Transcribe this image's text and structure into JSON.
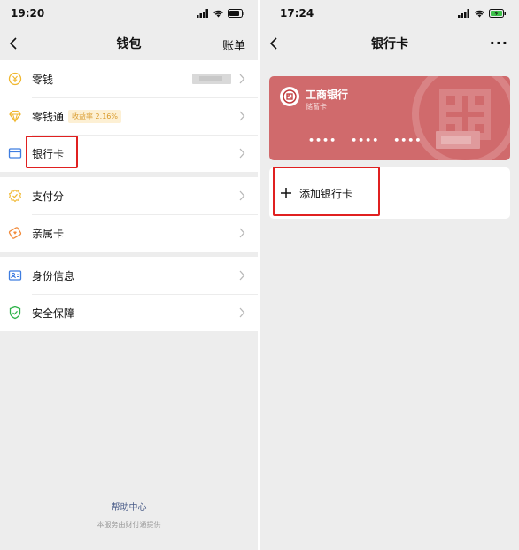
{
  "left": {
    "status_time": "19:20",
    "title": "钱包",
    "right_action": "账单",
    "groups": [
      [
        {
          "label": "零钱",
          "icon": "coin-icon"
        },
        {
          "label": "零钱通",
          "icon": "diamond-icon",
          "badge": "收益率 2.16%"
        },
        {
          "label": "银行卡",
          "icon": "card-icon"
        }
      ],
      [
        {
          "label": "支付分",
          "icon": "score-icon"
        },
        {
          "label": "亲属卡",
          "icon": "family-card-icon"
        }
      ],
      [
        {
          "label": "身份信息",
          "icon": "id-card-icon"
        },
        {
          "label": "安全保障",
          "icon": "shield-icon"
        }
      ]
    ],
    "help_center": "帮助中心",
    "provider_note": "本服务由财付通提供"
  },
  "right": {
    "status_time": "17:24",
    "title": "银行卡",
    "more": "···",
    "card": {
      "bank_name": "工商银行",
      "card_type": "储蓄卡",
      "dots": [
        "••••",
        "••••",
        "••••"
      ]
    },
    "add_card_label": "添加银行卡"
  },
  "colors": {
    "background": "#ededed",
    "card": "#d06a6c",
    "highlight": "#e02020",
    "icon_yellow": "#f0b72f",
    "icon_blue": "#3f7de0",
    "icon_green": "#2fb34a",
    "icon_orange": "#f18a3a",
    "link": "#4b5d89"
  }
}
